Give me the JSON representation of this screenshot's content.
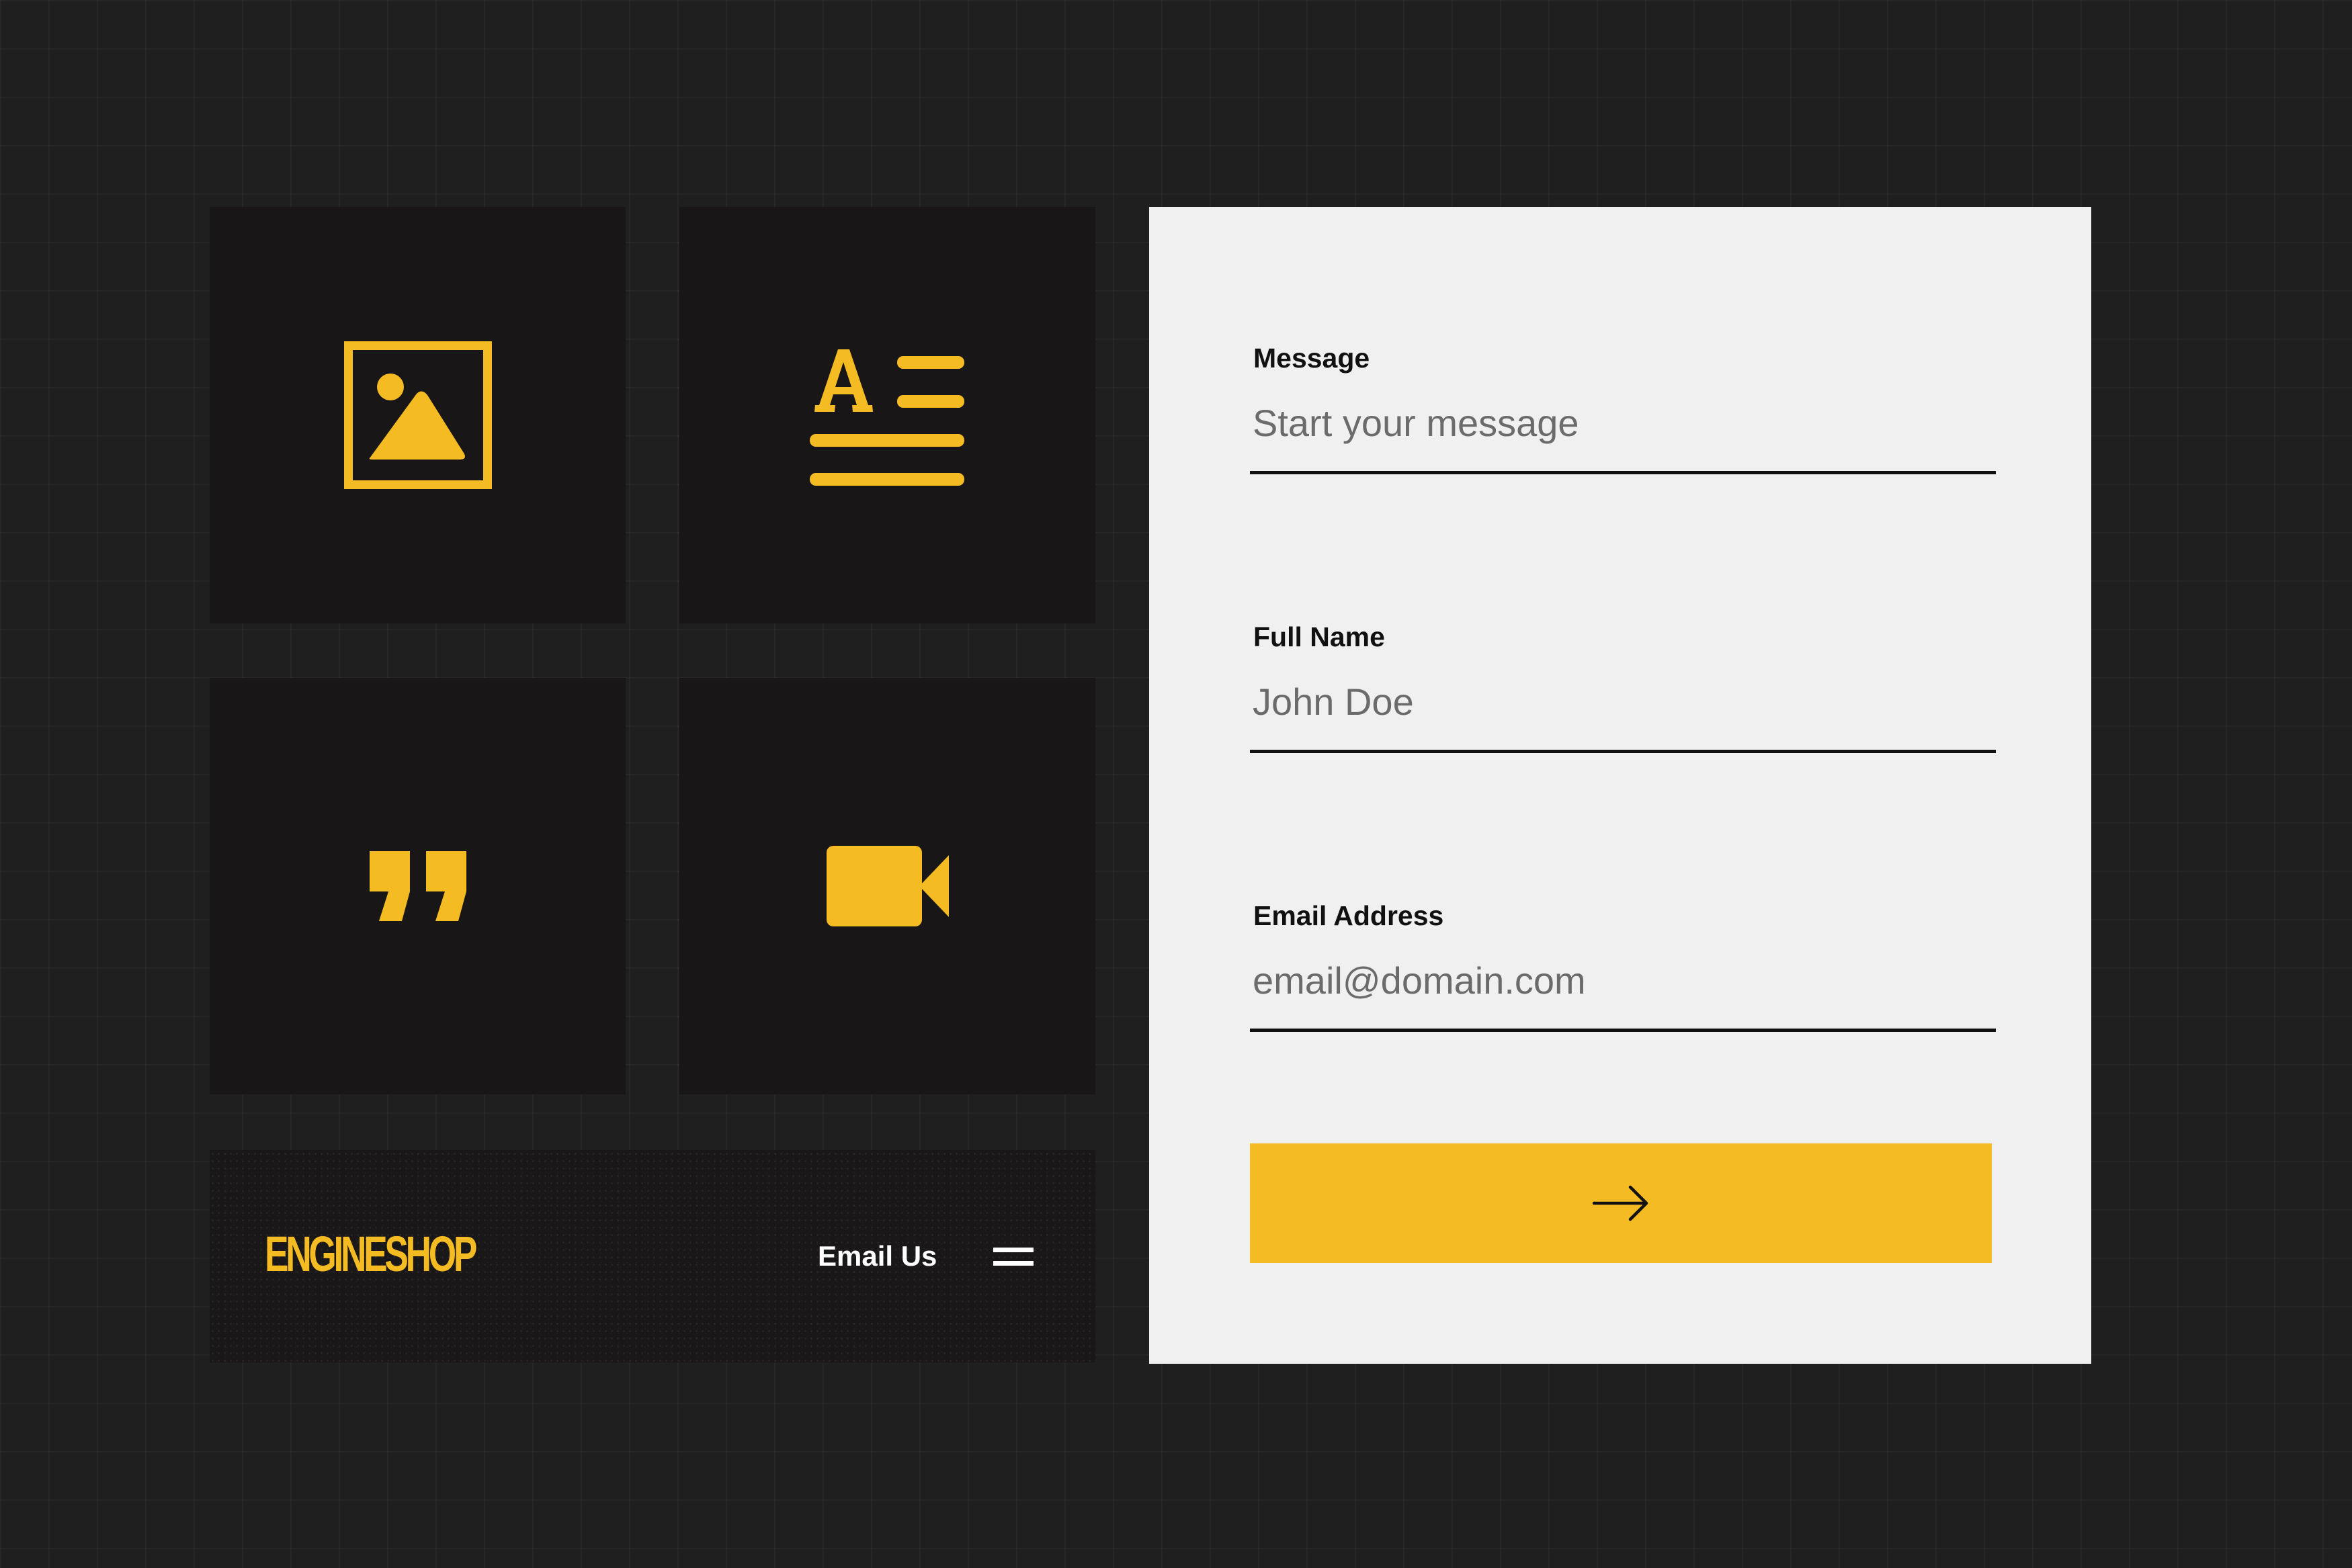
{
  "colors": {
    "accent": "#f5bb22",
    "background": "#1f1f1f",
    "tile": "#181617",
    "card": "#f0f0f0",
    "text_dark": "#111111",
    "text_light": "#ffffff"
  },
  "tiles": [
    {
      "icon": "image-icon"
    },
    {
      "icon": "text-format-icon"
    },
    {
      "icon": "quote-icon"
    },
    {
      "icon": "video-camera-icon"
    }
  ],
  "brand": {
    "logo": "ENGINESHOP",
    "email_link": "Email Us",
    "menu_icon": "hamburger-menu-icon"
  },
  "form": {
    "message": {
      "label": "Message",
      "placeholder": "Start your message"
    },
    "full_name": {
      "label": "Full Name",
      "placeholder": "John Doe"
    },
    "email": {
      "label": "Email Address",
      "placeholder": "email@domain.com"
    },
    "submit_icon": "arrow-right-icon"
  }
}
